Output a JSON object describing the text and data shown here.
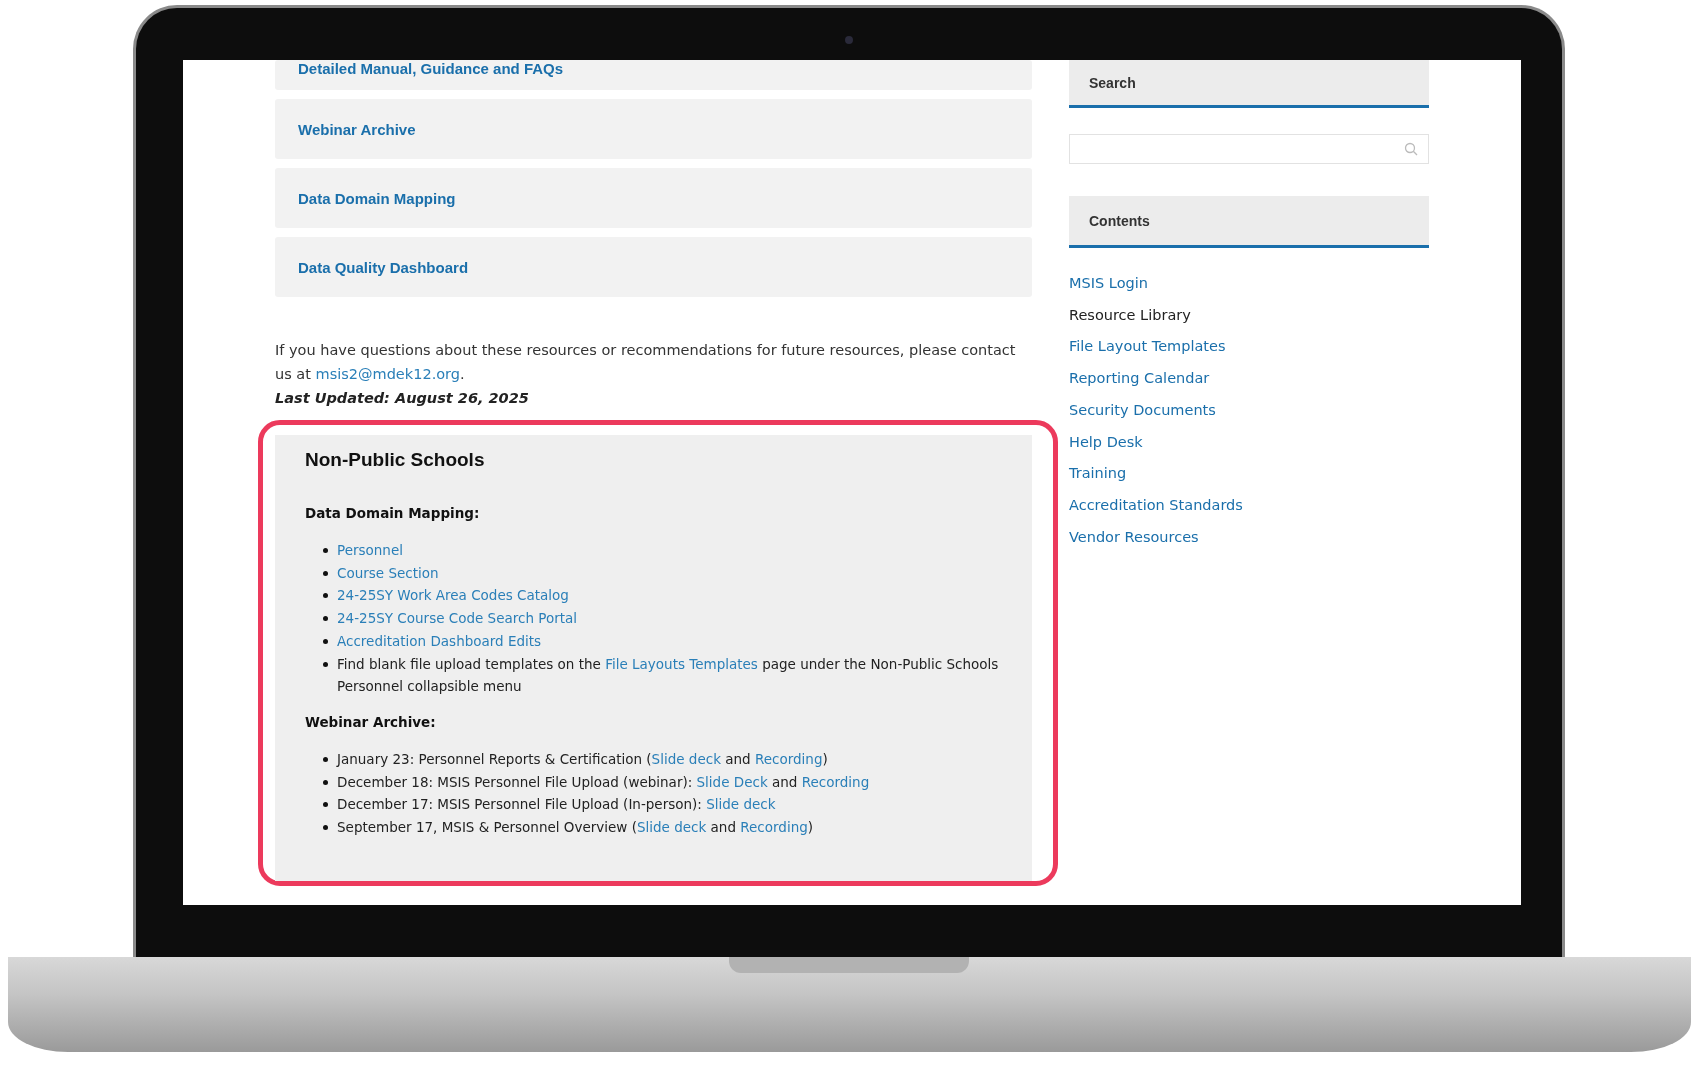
{
  "accordion": [
    {
      "label": "Detailed Manual, Guidance and FAQs"
    },
    {
      "label": "Webinar Archive"
    },
    {
      "label": "Data Domain Mapping"
    },
    {
      "label": "Data Quality Dashboard"
    }
  ],
  "contact": [
    {
      "kind": "text",
      "text": "If you have questions about these resources or recommendations for future resources, please contact us at "
    },
    {
      "kind": "link",
      "text": "msis2@mdek12.org"
    },
    {
      "kind": "text",
      "text": "."
    }
  ],
  "last_updated": "Last Updated: August 26, 2025",
  "section": {
    "title": "Non-Public Schools",
    "groups": [
      {
        "heading": "Data Domain Mapping:",
        "items": [
          [
            {
              "kind": "link",
              "text": "Personnel"
            }
          ],
          [
            {
              "kind": "link",
              "text": "Course Section"
            }
          ],
          [
            {
              "kind": "link",
              "text": "24-25SY Work Area Codes Catalog"
            }
          ],
          [
            {
              "kind": "link",
              "text": "24-25SY Course Code Search Portal"
            }
          ],
          [
            {
              "kind": "link",
              "text": "Accreditation Dashboard Edits"
            }
          ],
          [
            {
              "kind": "text",
              "text": "Find blank file upload templates on the "
            },
            {
              "kind": "link",
              "text": "File Layouts Templates"
            },
            {
              "kind": "text",
              "text": " page under the Non-Public Schools Personnel collapsible menu"
            }
          ]
        ]
      },
      {
        "heading": "Webinar Archive:",
        "items": [
          [
            {
              "kind": "text",
              "text": "January 23: Personnel Reports & Certification ("
            },
            {
              "kind": "link",
              "text": "Slide deck"
            },
            {
              "kind": "text",
              "text": " and "
            },
            {
              "kind": "link",
              "text": "Recording"
            },
            {
              "kind": "text",
              "text": ")"
            }
          ],
          [
            {
              "kind": "text",
              "text": "December 18: MSIS Personnel File Upload (webinar): "
            },
            {
              "kind": "link",
              "text": "Slide Deck"
            },
            {
              "kind": "text",
              "text": " and "
            },
            {
              "kind": "link",
              "text": "Recording"
            }
          ],
          [
            {
              "kind": "text",
              "text": "December 17: MSIS Personnel File Upload (In-person): "
            },
            {
              "kind": "link",
              "text": "Slide deck"
            }
          ],
          [
            {
              "kind": "text",
              "text": "September 17, MSIS & Personnel Overview ("
            },
            {
              "kind": "link",
              "text": "Slide deck"
            },
            {
              "kind": "text",
              "text": " and "
            },
            {
              "kind": "link",
              "text": "Recording"
            },
            {
              "kind": "text",
              "text": ")"
            }
          ]
        ]
      }
    ]
  },
  "sidebar": {
    "search_title": "Search",
    "contents_title": "Contents",
    "items": [
      {
        "label": "MSIS Login",
        "selected": false
      },
      {
        "label": "Resource Library",
        "selected": true
      },
      {
        "label": "File Layout Templates",
        "selected": false
      },
      {
        "label": "Reporting Calendar",
        "selected": false
      },
      {
        "label": "Security Documents",
        "selected": false
      },
      {
        "label": "Help Desk",
        "selected": false
      },
      {
        "label": "Training",
        "selected": false
      },
      {
        "label": "Accreditation Standards",
        "selected": false
      },
      {
        "label": "Vendor Resources",
        "selected": false
      }
    ]
  }
}
